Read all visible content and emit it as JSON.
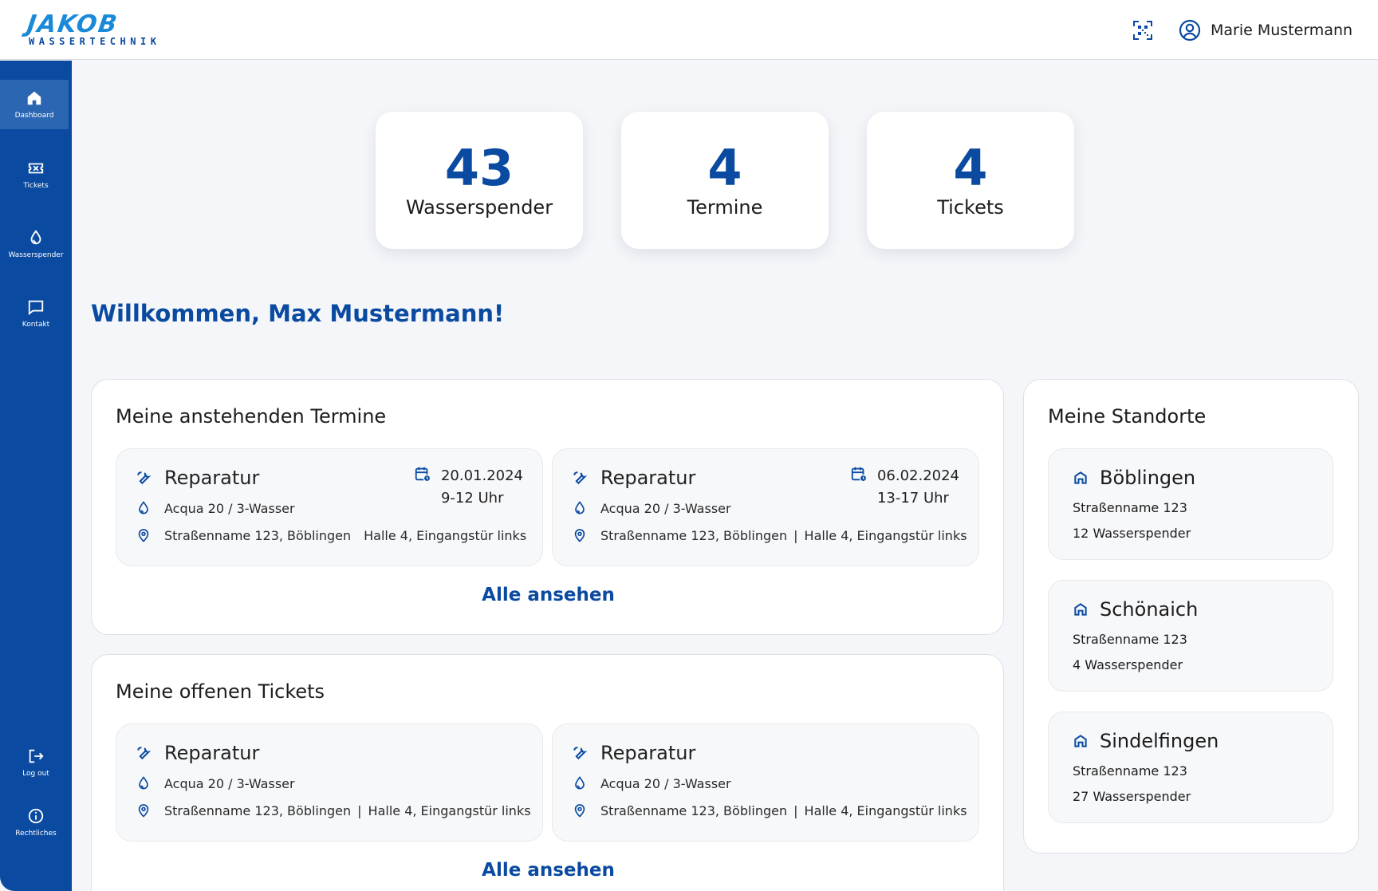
{
  "brand": {
    "name": "JAKOB",
    "tagline": "WASSERTECHNIK",
    "primary": "#0a4aa0",
    "accent": "#1a8ad8"
  },
  "header": {
    "qr_icon": "qr-code-icon",
    "user_icon": "user-circle-icon",
    "user_name": "Marie Mustermann"
  },
  "sidebar": {
    "items": [
      {
        "label": "Dashboard",
        "icon": "home-icon",
        "active": true
      },
      {
        "label": "Tickets",
        "icon": "ticket-icon"
      },
      {
        "label": "Wasserspender",
        "icon": "water-drop-icon"
      },
      {
        "label": "Kontakt",
        "icon": "chat-icon"
      }
    ],
    "bottom": [
      {
        "label": "Log out",
        "icon": "logout-icon"
      },
      {
        "label": "Rechtliches",
        "icon": "info-icon"
      }
    ]
  },
  "stats": [
    {
      "value": "43",
      "label": "Wasserspender"
    },
    {
      "value": "4",
      "label": "Termine"
    },
    {
      "value": "4",
      "label": "Tickets"
    }
  ],
  "welcome": "Willkommen, Max Mustermann!",
  "appointments": {
    "title": "Meine anstehenden Termine",
    "items": [
      {
        "type": "Reparatur",
        "product": "Acqua 20 / 3-Wasser",
        "address": "Straßenname 123, Böblingen",
        "location_detail": "Halle 4, Eingangstür links",
        "separator": "",
        "date": "20.01.2024",
        "time": "9-12 Uhr"
      },
      {
        "type": "Reparatur",
        "product": "Acqua 20 / 3-Wasser",
        "address": "Straßenname 123, Böblingen",
        "location_detail": "Halle 4, Eingangstür links",
        "separator": "|",
        "date": "06.02.2024",
        "time": "13-17 Uhr"
      }
    ],
    "link": "Alle ansehen"
  },
  "tickets": {
    "title": "Meine offenen Tickets",
    "items": [
      {
        "type": "Reparatur",
        "product": "Acqua 20 / 3-Wasser",
        "address": "Straßenname 123, Böblingen",
        "location_detail": "Halle 4, Eingangstür links",
        "separator": "|"
      },
      {
        "type": "Reparatur",
        "product": "Acqua 20 / 3-Wasser",
        "address": "Straßenname 123, Böblingen",
        "location_detail": "Halle 4, Eingangstür links",
        "separator": "|"
      }
    ],
    "link": "Alle ansehen"
  },
  "locations": {
    "title": "Meine Standorte",
    "items": [
      {
        "name": "Böblingen",
        "street": "Straßenname 123",
        "count": "12 Wasserspender"
      },
      {
        "name": "Schönaich",
        "street": "Straßenname 123",
        "count": "4 Wasserspender"
      },
      {
        "name": "Sindelfingen",
        "street": "Straßenname 123",
        "count": "27 Wasserspender"
      }
    ]
  }
}
